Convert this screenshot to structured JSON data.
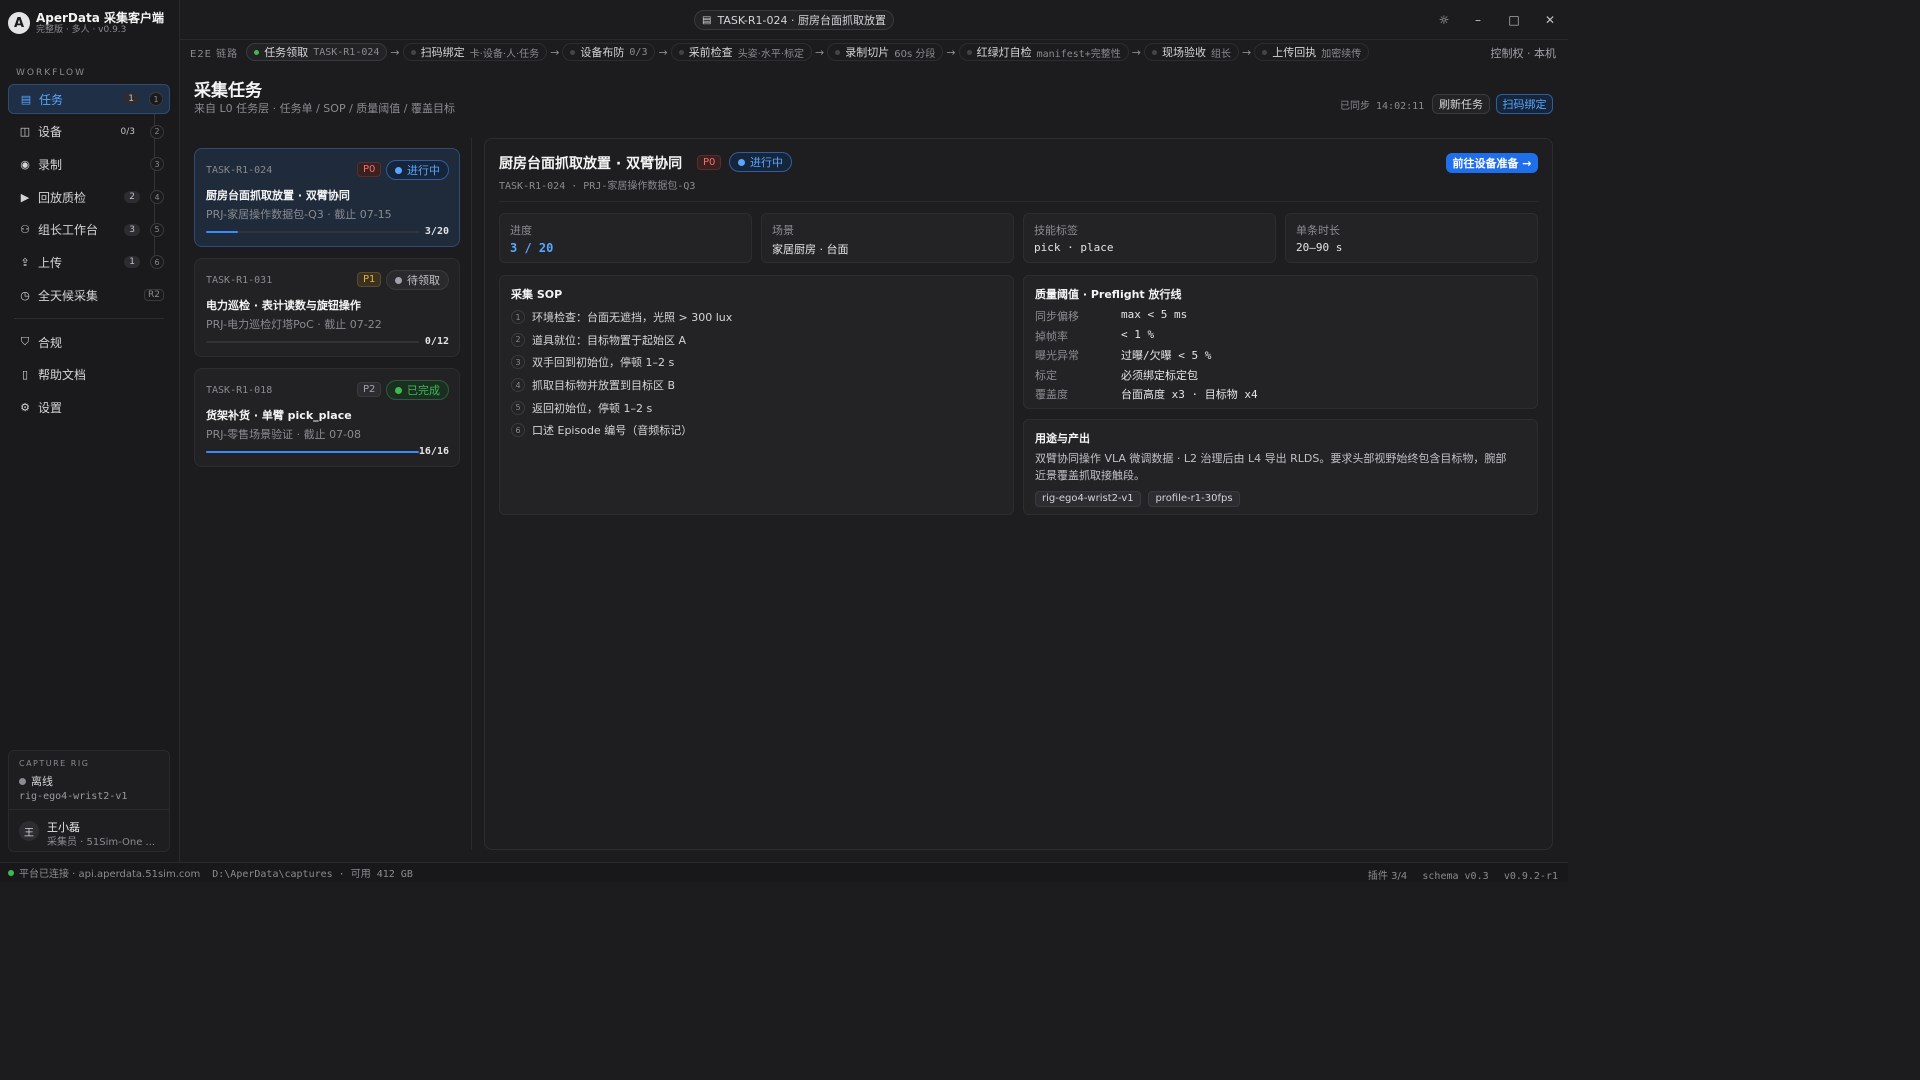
{
  "app": {
    "title": "AperData 采集客户端",
    "subtitle": "完整版 · 多人 · v0.9.3",
    "logo_letter": "A"
  },
  "sidebar": {
    "section_label": "WORKFLOW",
    "items": [
      {
        "label": "任务",
        "icon": "clipboard-icon",
        "count": "1",
        "step": "1",
        "active": true
      },
      {
        "label": "设备",
        "icon": "camera-icon",
        "count": "0/3",
        "step": "2"
      },
      {
        "label": "录制",
        "icon": "record-icon",
        "step": "3"
      },
      {
        "label": "回放质检",
        "icon": "playback-icon",
        "count": "2",
        "step": "4"
      },
      {
        "label": "组长工作台",
        "icon": "team-icon",
        "count": "3",
        "step": "5"
      },
      {
        "label": "上传",
        "icon": "upload-icon",
        "count": "1",
        "step": "6"
      },
      {
        "label": "全天候采集",
        "icon": "clock-icon",
        "tag": "R2"
      }
    ],
    "bottom_items": [
      {
        "label": "合规",
        "icon": "shield-icon"
      },
      {
        "label": "帮助文档",
        "icon": "book-icon"
      },
      {
        "label": "设置",
        "icon": "gear-icon"
      }
    ],
    "rig": {
      "label": "CAPTURE RIG",
      "status": "离线",
      "id": "rig-ego4-wrist2-v1"
    },
    "user": {
      "avatar": "王",
      "name": "王小磊",
      "role": "采集员 · 51Sim-One ..."
    }
  },
  "titlebar": {
    "window_title": "TASK-R1-024 · 厨房台面抓取放置"
  },
  "flow": {
    "label": "E2E 链路",
    "stages": [
      {
        "label": "任务领取",
        "sub": "TASK-R1-024",
        "active": true
      },
      {
        "label": "扫码绑定",
        "sub": "卡·设备·人·任务"
      },
      {
        "label": "设备布防",
        "sub": "0/3"
      },
      {
        "label": "采前检查",
        "sub": "头姿·水平·标定"
      },
      {
        "label": "录制切片",
        "sub": "60s 分段"
      },
      {
        "label": "红绿灯自检",
        "sub": "manifest+完整性"
      },
      {
        "label": "现场验收",
        "sub": "组长"
      },
      {
        "label": "上传回执",
        "sub": "加密续传"
      }
    ],
    "control": "控制权 · 本机"
  },
  "page": {
    "title": "采集任务",
    "subtitle": "来自 L0 任务层 · 任务单 / SOP / 质量阈值 / 覆盖目标",
    "sync": "已同步 14:02:11",
    "refresh_btn": "刷新任务",
    "scan_btn": "扫码绑定"
  },
  "tasks": [
    {
      "id": "TASK-R1-024",
      "priority": "P0",
      "status": "进行中",
      "title": "厨房台面抓取放置 · 双臂协同",
      "project": "PRJ-家居操作数据包-Q3 · 截止 07-15",
      "done": 3,
      "total": 20,
      "fraction": "3/20",
      "selected": true
    },
    {
      "id": "TASK-R1-031",
      "priority": "P1",
      "status": "待领取",
      "title": "电力巡检 · 表计读数与旋钮操作",
      "project": "PRJ-电力巡检灯塔PoC · 截止 07-22",
      "done": 0,
      "total": 12,
      "fraction": "0/12"
    },
    {
      "id": "TASK-R1-018",
      "priority": "P2",
      "status": "已完成",
      "title": "货架补货 · 单臂 pick_place",
      "project": "PRJ-零售场景验证 · 截止 07-08",
      "done": 16,
      "total": 16,
      "fraction": "16/16"
    }
  ],
  "detail": {
    "title": "厨房台面抓取放置 · 双臂协同",
    "priority": "P0",
    "status": "进行中",
    "sub": "TASK-R1-024 · PRJ-家居操作数据包-Q3",
    "go_btn": "前往设备准备 →",
    "stats": [
      {
        "label": "进度",
        "value": "3 / 20"
      },
      {
        "label": "场景",
        "value": "家居厨房 · 台面"
      },
      {
        "label": "技能标签",
        "value": "pick · place"
      },
      {
        "label": "单条时长",
        "value": "20–90 s"
      }
    ],
    "sop_title": "采集 SOP",
    "sop": [
      "环境检查：台面无遮挡，光照 > 300 lux",
      "道具就位：目标物置于起始区 A",
      "双手回到初始位，停顿 1–2 s",
      "抓取目标物并放置到目标区 B",
      "返回初始位，停顿 1–2 s",
      "口述 Episode 编号（音频标记）"
    ],
    "quality_title": "质量阈值 · Preflight 放行线",
    "quality": [
      {
        "k": "同步偏移",
        "v": "max < 5 ms"
      },
      {
        "k": "掉帧率",
        "v": "< 1 %"
      },
      {
        "k": "曝光异常",
        "v": "过曝/欠曝 < 5 %"
      },
      {
        "k": "标定",
        "v": "必须绑定标定包"
      },
      {
        "k": "覆盖度",
        "v": "台面高度 x3 · 目标物 x4"
      }
    ],
    "use_title": "用途与产出",
    "use_text": "双臂协同操作 VLA 微调数据 · L2 治理后由 L4 导出 RLDS。要求头部视野始终包含目标物，腕部近景覆盖抓取接触段。",
    "tags": [
      "rig-ego4-wrist2-v1",
      "profile-r1-30fps"
    ]
  },
  "statusbar": {
    "conn": "平台已连接 · api.aperdata.51sim.com",
    "path": "D:\\AperData\\captures · 可用 412 GB",
    "plugins": "插件 3/4",
    "schema": "schema v0.3",
    "version": "v0.9.2-r1"
  },
  "colors": {
    "accent": "#1f6feb",
    "success": "#3fb950",
    "danger": "#f47067",
    "warning": "#e3b341"
  }
}
